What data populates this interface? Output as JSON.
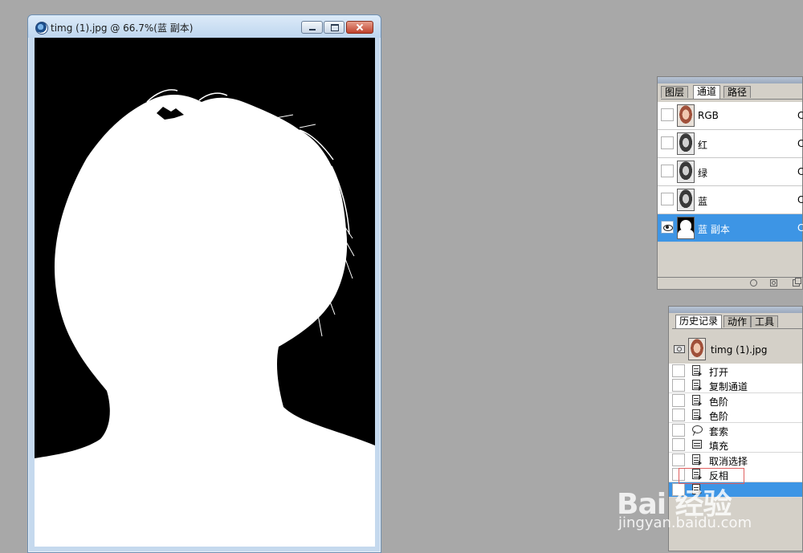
{
  "document_window": {
    "title": "timg (1).jpg @ 66.7%(蓝 副本)"
  },
  "channels_panel": {
    "tabs": [
      {
        "label": "图层",
        "active": false
      },
      {
        "label": "通道",
        "active": true
      },
      {
        "label": "路径",
        "active": false
      }
    ],
    "rows": [
      {
        "label": "RGB",
        "shortcut": "C",
        "thumb": "color",
        "visible": false,
        "selected": false
      },
      {
        "label": "红",
        "shortcut": "C",
        "thumb": "gray",
        "visible": false,
        "selected": false
      },
      {
        "label": "绿",
        "shortcut": "C",
        "thumb": "gray",
        "visible": false,
        "selected": false
      },
      {
        "label": "蓝",
        "shortcut": "C",
        "thumb": "gray",
        "visible": false,
        "selected": false
      },
      {
        "label": "蓝 副本",
        "shortcut": "C",
        "thumb": "mask",
        "visible": true,
        "selected": true
      }
    ]
  },
  "history_panel": {
    "tabs": [
      {
        "label": "历史记录",
        "active": true
      },
      {
        "label": "动作",
        "active": false
      },
      {
        "label": "工具",
        "active": false
      }
    ],
    "snapshot": {
      "label": "timg (1).jpg"
    },
    "steps": [
      {
        "label": "打开",
        "icon": "step-icon",
        "selected": false
      },
      {
        "label": "复制通道",
        "icon": "step-icon",
        "selected": false
      },
      {
        "label": "色阶",
        "icon": "step-icon",
        "selected": false
      },
      {
        "label": "色阶",
        "icon": "step-icon",
        "selected": false
      },
      {
        "label": "套索",
        "icon": "lasso-icon",
        "selected": false
      },
      {
        "label": "填充",
        "icon": "fill-icon",
        "selected": false
      },
      {
        "label": "取消选择",
        "icon": "step-icon",
        "selected": false
      },
      {
        "label": "反相",
        "icon": "step-icon",
        "selected": false
      },
      {
        "label": "",
        "icon": "step-icon",
        "selected": true
      }
    ]
  },
  "watermark": {
    "logo": "Bai 经验",
    "url": "jingyan.baidu.com"
  },
  "colors": {
    "workspace": "#a8a8a8",
    "selection": "#3d95e5",
    "palette": "#d4d0c8"
  }
}
